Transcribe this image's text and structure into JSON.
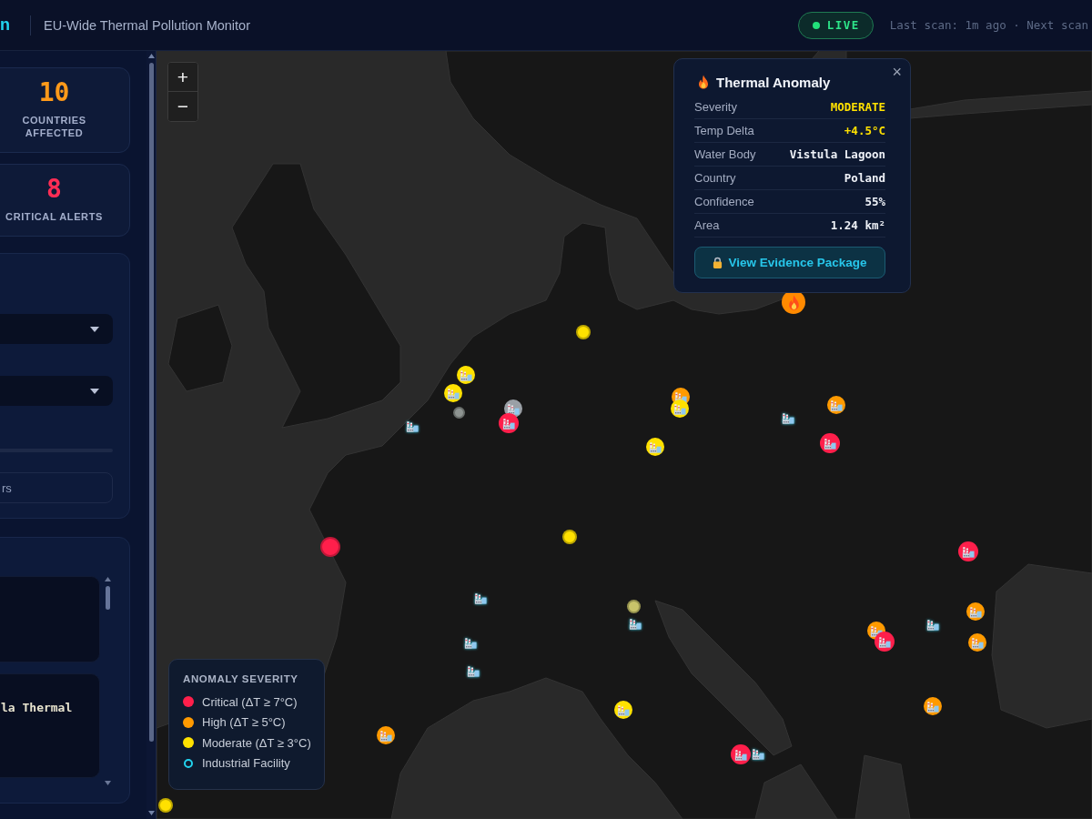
{
  "header": {
    "logo_text": "n",
    "title": "EU-Wide Thermal Pollution Monitor",
    "live_label": "LIVE",
    "scan_status": "Last scan: 1m ago · Next scan"
  },
  "sidebar": {
    "stats": [
      {
        "value": "10",
        "label": "COUNTRIES AFFECTED",
        "color": "#ff9a1a"
      },
      {
        "value": "8",
        "label": "CRITICAL ALERTS",
        "color": "#ff2d55"
      }
    ],
    "filter_panel": {
      "button_label": "rs"
    },
    "alert_cards": [
      {
        "kind": "blank"
      },
      {
        "kind": "titled",
        "title": "la Thermal"
      }
    ]
  },
  "map": {
    "zoom_controls": [
      {
        "label": "+"
      },
      {
        "label": "−"
      }
    ],
    "markers": [
      {
        "kind": "anomaly",
        "color": "#ffe100",
        "selected": false
      },
      {
        "kind": "anomaly",
        "color": "#ff8a00",
        "selected": true
      },
      {
        "kind": "anomaly",
        "color": "#ff1f4b",
        "selected": false
      },
      {
        "kind": "anomaly",
        "color": "#ffe100",
        "selected": false
      },
      {
        "kind": "anomaly",
        "color": "#8e9491",
        "selected": false
      },
      {
        "kind": "anomaly",
        "color": "#c9c46a",
        "selected": false
      },
      {
        "kind": "anomaly",
        "color": "#ffe100",
        "selected": false
      },
      {
        "kind": "facility",
        "color": "#ffe100"
      },
      {
        "kind": "facility",
        "color": "#ffe100"
      },
      {
        "kind": "facility",
        "color": "#9aa0a6"
      },
      {
        "kind": "facility",
        "color": "#ff1f4b"
      },
      {
        "kind": "facility"
      },
      {
        "kind": "facility",
        "color": "#ff9a00"
      },
      {
        "kind": "facility",
        "color": "#ffe100"
      },
      {
        "kind": "facility",
        "color": "#ffe100"
      },
      {
        "kind": "facility",
        "color": "#ff9a00"
      },
      {
        "kind": "facility"
      },
      {
        "kind": "facility",
        "color": "#ff1f4b"
      },
      {
        "kind": "facility"
      },
      {
        "kind": "facility"
      },
      {
        "kind": "facility"
      },
      {
        "kind": "facility"
      },
      {
        "kind": "facility",
        "color": "#ffe100"
      },
      {
        "kind": "facility",
        "color": "#ff9a00"
      },
      {
        "kind": "facility",
        "color": "#ff1f4b"
      },
      {
        "kind": "facility"
      },
      {
        "kind": "facility",
        "color": "#ff9a00"
      },
      {
        "kind": "facility",
        "color": "#ff1f4b"
      },
      {
        "kind": "facility"
      },
      {
        "kind": "facility",
        "color": "#ff9a00"
      },
      {
        "kind": "facility",
        "color": "#ff9a00"
      },
      {
        "kind": "facility",
        "color": "#ff9a00"
      },
      {
        "kind": "facility",
        "color": "#ff1f4b"
      }
    ],
    "popup": {
      "title": "Thermal Anomaly",
      "close": "×",
      "rows": [
        {
          "label": "Severity",
          "value": "MODERATE",
          "highlight": true
        },
        {
          "label": "Temp Delta",
          "value": "+4.5°C",
          "highlight": true
        },
        {
          "label": "Water Body",
          "value": "Vistula Lagoon",
          "highlight": false
        },
        {
          "label": "Country",
          "value": "Poland",
          "highlight": false
        },
        {
          "label": "Confidence",
          "value": "55%",
          "highlight": false
        },
        {
          "label": "Area",
          "value": "1.24 km²",
          "highlight": false
        }
      ],
      "button": "View Evidence Package"
    },
    "legend": {
      "title": "ANOMALY SEVERITY",
      "items": [
        {
          "kind": "dot",
          "color": "#ff1f4b",
          "label": "Critical (ΔT ≥ 7°C)"
        },
        {
          "kind": "dot",
          "color": "#ff9a00",
          "label": "High (ΔT ≥ 5°C)"
        },
        {
          "kind": "dot",
          "color": "#ffe100",
          "label": "Moderate (ΔT ≥ 3°C)"
        },
        {
          "kind": "ring",
          "color": "#22d3ee",
          "label": "Industrial Facility"
        }
      ]
    }
  }
}
